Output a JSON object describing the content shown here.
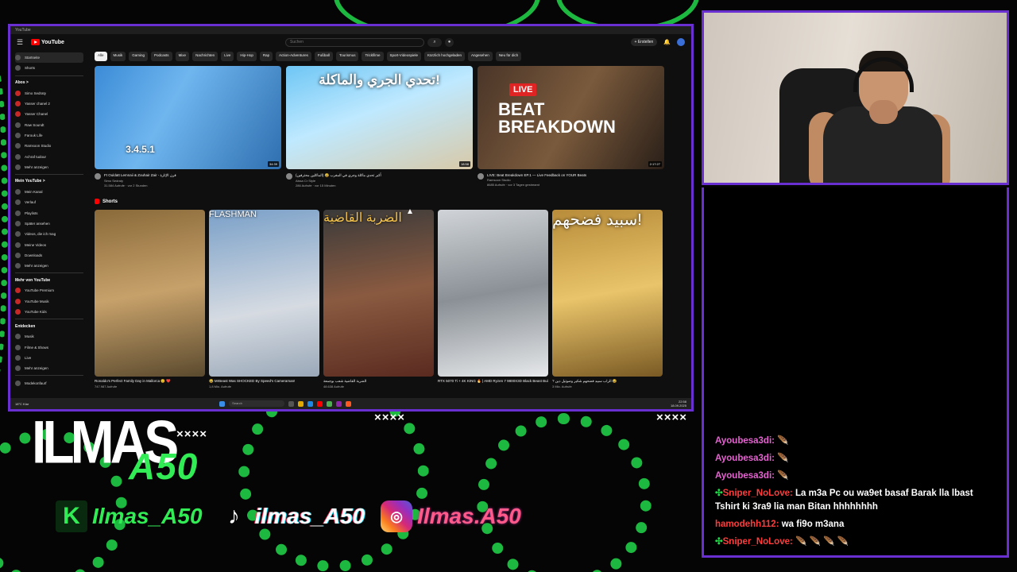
{
  "window": {
    "title": "YouTube"
  },
  "header": {
    "logo_text": "YouTube",
    "search_placeholder": "Suchen",
    "create_label": "+ Erstellen"
  },
  "sidebar": {
    "main": [
      "Startseite",
      "Shorts"
    ],
    "subs_header": "Abos >",
    "subs": [
      "Simo Sedraty",
      "Yasser chanel 2",
      "Yasser Chanel",
      "Raw Soundt",
      "Farouk Life",
      "Ramsoon Studio",
      "Achraf tudour",
      "Mehr anzeigen"
    ],
    "you_header": "Mein YouTube >",
    "you": [
      "Mein Kanal",
      "Verlauf",
      "Playlists",
      "Später ansehen",
      "Videos, die ich mag",
      "Meine Videos",
      "Downloads",
      "Mehr anzeigen"
    ],
    "more_header": "Mehr von YouTube",
    "more": [
      "YouTube Premium",
      "YouTube Musik",
      "YouTube Kids"
    ],
    "explore_header": "Entdecken",
    "explore": [
      "Musik",
      "Filme & Shows",
      "Live",
      "Mehr anzeigen"
    ],
    "bottom": "Modekonfaurf"
  },
  "chips": [
    "Alle",
    "Musik",
    "Gaming",
    "Podcasts",
    "Mixe",
    "Nachrichten",
    "Live",
    "Hip-Hop",
    "Rap",
    "Action-Adventures",
    "Fußball",
    "Tourismus",
    "Trickfilme",
    "Sport-Videospiele",
    "Kürzlich hochgeladen",
    "Angesehen",
    "Neu für dich"
  ],
  "videos": [
    {
      "title": "Ft Ouldatt Lemnaii & Zouhair Zair - قرن الإثارة",
      "channel": "Simo Sedraty",
      "stats": "31.584 Aufrufe · vor 2 Stunden",
      "duration": "34:39",
      "overlay": "3.4.5.1",
      "bg": "linear-gradient(120deg,#3b8bd6,#6fb6ef 40%,#2f6fb0)"
    },
    {
      "title": "أكبر تحدي ماكلة وجري في المغرب 😂 (الماكلين محترفين)",
      "channel": "Aissa Cr Style",
      "stats": "286 Aufrufe · vor 15 Minuten",
      "duration": "18:58",
      "overlay": "تحدي الجري والماكلة!",
      "bg": "linear-gradient(160deg,#6ec6f5,#bfe9ff 45%,#d8c9a8)"
    },
    {
      "title": "LIVE: Beat Breakdown EP.1 — Live Feedback on YOUR Beats",
      "channel": "Ramsoon Studio",
      "stats": "8685 Aufrufe · vor 3 Tagen gestreamt",
      "duration": "2:17:27",
      "overlay": "BEAT BREAKDOWN",
      "bg": "linear-gradient(120deg,#4a3528,#7a5a3c 50%,#2a1f18)"
    }
  ],
  "live_badge": "LIVE",
  "shorts_title": "Shorts",
  "shorts": [
    {
      "title": "Ronaldo's Perfect Family Day in Mallorca 😊 ❤️",
      "views": "747.987 Aufrufe",
      "bg": "linear-gradient(170deg,#8a6a3a,#c7a16a 50%,#5b4a2e)"
    },
    {
      "title": "😂 MrBeast Was SHOCKED By Speed's Cameraman!",
      "views": "1,8 Mio. Aufrufe",
      "overlay": "FLASHMAN",
      "bg": "linear-gradient(170deg,#7aa0c8,#d6dbe2 60%,#9aa8b8)"
    },
    {
      "title": "الضربة القاضية شعب بوجمعة",
      "views": "48.638 Aufrufe",
      "overlay": "الضربة القاضية",
      "bg": "linear-gradient(170deg,#3a3a3a,#8a5a40 50%,#5a2a20)"
    },
    {
      "title": "RTX 5070 Ti + 4K KING 🔥 | AMD Ryzen 7 9800X3D Black Beast Build 🔥",
      "views": "",
      "bg": "linear-gradient(170deg,#d0d4d8,#8a9096 50%,#e6e8ea)"
    },
    {
      "title": "? الراب سبيد فضحهم شكير وصوتيل دين 😂",
      "views": "3 Mio. Aufrufe",
      "overlay": "سبيد فضحهم!",
      "bg": "linear-gradient(170deg,#b88c3a,#e9c46a 50%,#7a5a24)"
    }
  ],
  "taskbar": {
    "search": "Search",
    "weather": "18°C Klar",
    "time": "22:58",
    "date": "18.09.2025"
  },
  "branding": {
    "name": "ILMAS",
    "suffix": "A50",
    "mark": "××××",
    "kick_handle": "Ilmas_A50",
    "tiktok_handle": "ilmas_A50",
    "insta_handle": "Ilmas.A50"
  },
  "chat": [
    {
      "user": "Ayoubesa3di:",
      "msg": "🪶",
      "color": "pink",
      "badge": ""
    },
    {
      "user": "Ayoubesa3di:",
      "msg": "🪶",
      "color": "pink",
      "badge": ""
    },
    {
      "user": "Ayoubesa3di:",
      "msg": "🪶",
      "color": "pink",
      "badge": ""
    },
    {
      "user": "Sniper_NoLove:",
      "msg": "La m3a Pc ou wa9et basaf Barak lla lbast Tshirt ki 3ra9 lia man Bitan hhhhhhhh",
      "color": "red",
      "badge": "✣"
    },
    {
      "user": "hamodehh112:",
      "msg": "wa fi9o m3ana",
      "color": "red",
      "badge": ""
    },
    {
      "user": "Sniper_NoLove:",
      "msg": "🪶 🪶 🪶 🪶",
      "color": "red",
      "badge": "✣"
    }
  ],
  "colors": {
    "accent": "#6a2fd0",
    "green": "#31ec54",
    "yt_red": "#ff0000"
  }
}
